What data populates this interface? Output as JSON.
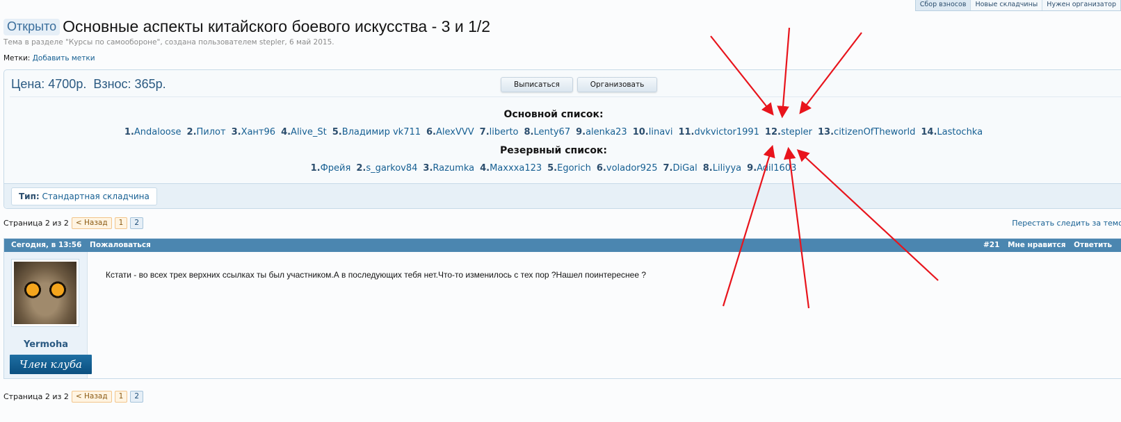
{
  "top_tabs": [
    "Сбор взносов",
    "Новые складчины",
    "Нужен организатор"
  ],
  "thread": {
    "prefix": "Открыто",
    "title": "Основные аспекты китайского боевого искусства - 3 и 1/2",
    "meta": "Тема в разделе \"Курсы по самообороне\", создана пользователем stepler, 6 май 2015.",
    "tags_label": "Метки:",
    "tags_link": "Добавить метки"
  },
  "groupbuy": {
    "price": "Цена: 4700р.",
    "fee": "Взнос: 365р.",
    "unsubscribe": "Выписаться",
    "organize": "Организовать",
    "main_title": "Основной список:",
    "main_list": [
      {
        "n": "1.",
        "name": "Andaloose"
      },
      {
        "n": "2.",
        "name": "Пилот"
      },
      {
        "n": "3.",
        "name": "Хант96"
      },
      {
        "n": "4.",
        "name": "Alive_St"
      },
      {
        "n": "5.",
        "name": "Владимир vk711"
      },
      {
        "n": "6.",
        "name": "AlexVVV"
      },
      {
        "n": "7.",
        "name": "liberto"
      },
      {
        "n": "8.",
        "name": "Lenty67"
      },
      {
        "n": "9.",
        "name": "alenka23"
      },
      {
        "n": "10.",
        "name": "linavi"
      },
      {
        "n": "11.",
        "name": "dvkvictor1991"
      },
      {
        "n": "12.",
        "name": "stepler"
      },
      {
        "n": "13.",
        "name": "citizenOfTheworld"
      },
      {
        "n": "14.",
        "name": "Lastochka"
      }
    ],
    "reserve_title": "Резервный список:",
    "reserve_list": [
      {
        "n": "1.",
        "name": "Фрейя"
      },
      {
        "n": "2.",
        "name": "s_garkov84"
      },
      {
        "n": "3.",
        "name": "Razumka"
      },
      {
        "n": "4.",
        "name": "Maxxxa123"
      },
      {
        "n": "5.",
        "name": "Egorich"
      },
      {
        "n": "6.",
        "name": "volador925"
      },
      {
        "n": "7.",
        "name": "DiGal"
      },
      {
        "n": "8.",
        "name": "Liliyya"
      },
      {
        "n": "9.",
        "name": "Adil1603"
      }
    ],
    "type_label": "Тип:",
    "type_value": "Стандартная складчина"
  },
  "pagination": {
    "label": "Страница 2 из 2",
    "prev": "< Назад",
    "pages": [
      "1",
      "2"
    ],
    "current": "2",
    "unwatch": "Перестать следить за темой"
  },
  "post": {
    "date": "Сегодня, в 13:56",
    "report": "Пожаловаться",
    "number": "#21",
    "like": "Мне нравится",
    "reply": "Ответить",
    "username": "Yermoha",
    "badge": "Член клуба",
    "message": "Кстати - во всех трех верхних ссылках ты был участником.А в последующих тебя нет.Что-то изменилось с тех пор ?Нашел поинтереснее ?"
  },
  "colors": {
    "accent": "#176093",
    "post_bar": "#4b86b0",
    "arrow": "#e8141c"
  }
}
